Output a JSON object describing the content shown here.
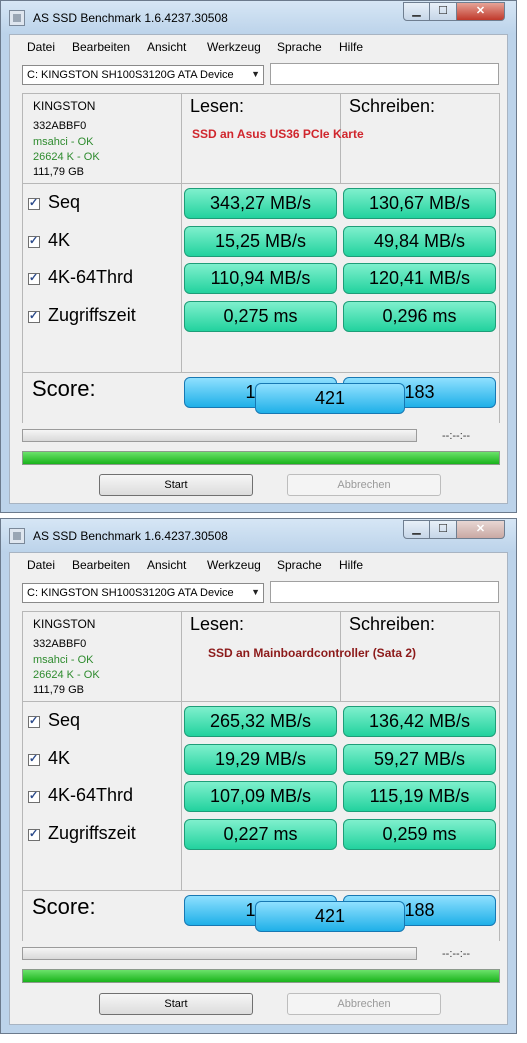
{
  "windows": [
    {
      "title": "AS SSD Benchmark 1.6.4237.30508",
      "close_active": true,
      "menu": [
        "Datei",
        "Bearbeiten",
        "Ansicht",
        "Werkzeug",
        "Sprache",
        "Hilfe"
      ],
      "drive_select": "C: KINGSTON SH100S3120G ATA Device",
      "drive_info": {
        "model": "KINGSTON",
        "firmware": "332ABBF0",
        "driver": "msahci - OK",
        "alignment": "26624 K - OK",
        "size": "111,79 GB"
      },
      "read_header": "Lesen:",
      "write_header": "Schreiben:",
      "annotation": "SSD an Asus US36 PCIe Karte",
      "annotation_color": "#d0262d",
      "rows": [
        {
          "label": "Seq",
          "read": "343,27 MB/s",
          "write": "130,67 MB/s"
        },
        {
          "label": "4K",
          "read": "15,25 MB/s",
          "write": "49,84 MB/s"
        },
        {
          "label": "4K-64Thrd",
          "read": "110,94 MB/s",
          "write": "120,41 MB/s"
        },
        {
          "label": "Zugriffszeit",
          "read": "0,275 ms",
          "write": "0,296 ms"
        }
      ],
      "score_label": "Score:",
      "score_read": "161",
      "score_write": "183",
      "score_total": "421",
      "timer": "--:--:--",
      "progress_percent": 100,
      "start_label": "Start",
      "cancel_label": "Abbrechen"
    },
    {
      "title": "AS SSD Benchmark 1.6.4237.30508",
      "close_active": false,
      "menu": [
        "Datei",
        "Bearbeiten",
        "Ansicht",
        "Werkzeug",
        "Sprache",
        "Hilfe"
      ],
      "drive_select": "C: KINGSTON SH100S3120G ATA Device",
      "drive_info": {
        "model": "KINGSTON",
        "firmware": "332ABBF0",
        "driver": "msahci - OK",
        "alignment": "26624 K - OK",
        "size": "111,79 GB"
      },
      "read_header": "Lesen:",
      "write_header": "Schreiben:",
      "annotation": "SSD an Mainboardcontroller (Sata 2)",
      "annotation_color": "#8c1a1a",
      "rows": [
        {
          "label": "Seq",
          "read": "265,32 MB/s",
          "write": "136,42 MB/s"
        },
        {
          "label": "4K",
          "read": "19,29 MB/s",
          "write": "59,27 MB/s"
        },
        {
          "label": "4K-64Thrd",
          "read": "107,09 MB/s",
          "write": "115,19 MB/s"
        },
        {
          "label": "Zugriffszeit",
          "read": "0,227 ms",
          "write": "0,259 ms"
        }
      ],
      "score_label": "Score:",
      "score_read": "153",
      "score_write": "188",
      "score_total": "421",
      "timer": "--:--:--",
      "progress_percent": 100,
      "start_label": "Start",
      "cancel_label": "Abbrechen"
    }
  ],
  "icons": {
    "minimize": "minimize-icon",
    "maximize": "maximize-icon",
    "close": "close-icon",
    "dropdown": "chevron-down-icon",
    "checkbox": "checkmark-icon"
  }
}
